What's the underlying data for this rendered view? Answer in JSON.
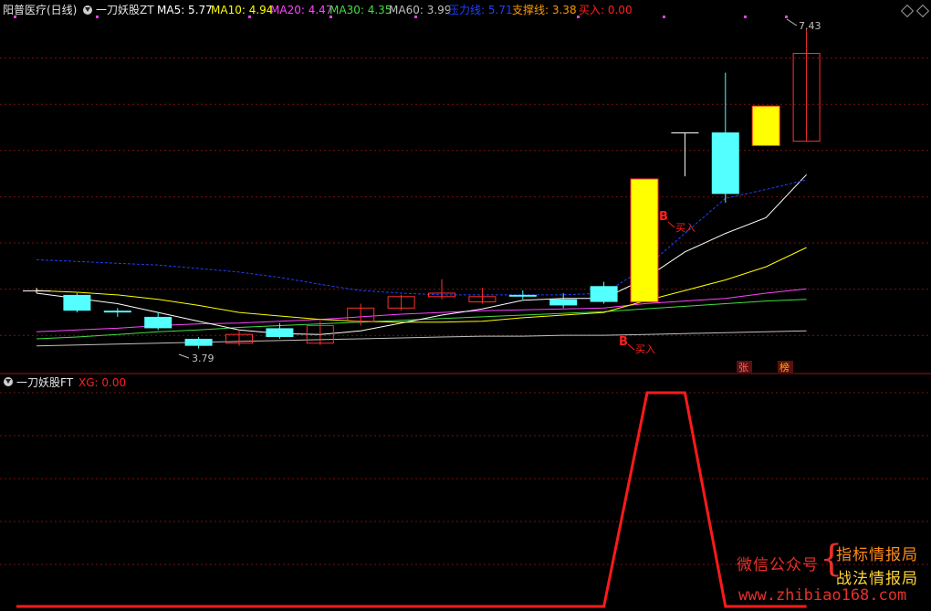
{
  "header": {
    "stock_title": "阳普医疗(日线)",
    "indicator_name": "一刀妖股ZT",
    "ma5": "MA5: 5.77",
    "ma10": "MA10: 4.94",
    "ma20": "MA20: 4.47",
    "ma30": "MA30: 4.35",
    "ma60": "MA60: 3.99",
    "pressure": "压力线: 5.71",
    "support": "支撑线: 3.38",
    "buy": "买入: 0.00"
  },
  "colors": {
    "ma5": "#ffffff",
    "ma10": "#ffff00",
    "ma20": "#ff44ff",
    "ma30": "#44dd44",
    "ma60": "#c0c0c0",
    "pressure": "#2040ff",
    "support": "#ff9900",
    "buy": "#ff2020",
    "grid": "#7a1010",
    "up": "#ff3030",
    "down": "#54ffff",
    "limit_up": "#ffff00"
  },
  "chart_labels": {
    "high_label": "7.43",
    "low_label": "3.79",
    "signal_b": "B",
    "signal_buy": "买入",
    "tag_zhang": "张",
    "tag_bang": "榜"
  },
  "subpanel": {
    "indicator_name": "一刀妖股FT",
    "xg": "XG: 0.00"
  },
  "chart_data": [
    {
      "type": "candlestick",
      "title": "阳普医疗(日线)",
      "candles": [
        {
          "o": 4.45,
          "c": 4.45,
          "h": 4.48,
          "l": 4.42
        },
        {
          "o": 4.4,
          "c": 4.22,
          "h": 4.42,
          "l": 4.2
        },
        {
          "o": 4.22,
          "c": 4.2,
          "h": 4.25,
          "l": 4.15
        },
        {
          "o": 4.15,
          "c": 4.02,
          "h": 4.2,
          "l": 4.0
        },
        {
          "o": 3.9,
          "c": 3.82,
          "h": 3.92,
          "l": 3.79
        },
        {
          "o": 3.85,
          "c": 3.95,
          "h": 4.0,
          "l": 3.82
        },
        {
          "o": 4.02,
          "c": 3.92,
          "h": 4.08,
          "l": 3.9
        },
        {
          "o": 3.85,
          "c": 4.05,
          "h": 4.1,
          "l": 3.83
        },
        {
          "o": 4.1,
          "c": 4.25,
          "h": 4.3,
          "l": 4.05
        },
        {
          "o": 4.25,
          "c": 4.38,
          "h": 4.4,
          "l": 4.22
        },
        {
          "o": 4.38,
          "c": 4.42,
          "h": 4.58,
          "l": 4.35
        },
        {
          "o": 4.32,
          "c": 4.38,
          "h": 4.48,
          "l": 4.3
        },
        {
          "o": 4.4,
          "c": 4.38,
          "h": 4.45,
          "l": 4.35
        },
        {
          "o": 4.35,
          "c": 4.28,
          "h": 4.42,
          "l": 4.25
        },
        {
          "o": 4.5,
          "c": 4.32,
          "h": 4.55,
          "l": 4.3
        },
        {
          "o": 4.32,
          "c": 5.72,
          "h": 5.72,
          "l": 4.32
        },
        {
          "o": 6.25,
          "c": 6.25,
          "h": 6.25,
          "l": 5.75
        },
        {
          "o": 6.25,
          "c": 5.55,
          "h": 6.93,
          "l": 5.45
        },
        {
          "o": 6.55,
          "c": 6.1,
          "h": 6.55,
          "l": 6.1
        },
        {
          "o": 6.15,
          "c": 7.15,
          "h": 7.43,
          "l": 6.15
        }
      ],
      "ma5": [
        4.42,
        4.36,
        4.3,
        4.2,
        4.1,
        4.0,
        3.96,
        3.95,
        3.99,
        4.08,
        4.17,
        4.24,
        4.34,
        4.36,
        4.36,
        4.58,
        4.89,
        5.1,
        5.28,
        5.77
      ],
      "ma10": [
        4.45,
        4.43,
        4.4,
        4.35,
        4.28,
        4.2,
        4.16,
        4.12,
        4.1,
        4.09,
        4.09,
        4.1,
        4.14,
        4.17,
        4.2,
        4.33,
        4.45,
        4.57,
        4.72,
        4.94
      ],
      "ma20": [
        3.98,
        4.0,
        4.02,
        4.05,
        4.07,
        4.08,
        4.1,
        4.12,
        4.15,
        4.18,
        4.2,
        4.22,
        4.23,
        4.24,
        4.25,
        4.3,
        4.33,
        4.36,
        4.42,
        4.47
      ],
      "ma30": [
        3.9,
        3.92,
        3.95,
        3.98,
        4.0,
        4.03,
        4.05,
        4.07,
        4.09,
        4.11,
        4.13,
        4.15,
        4.17,
        4.19,
        4.21,
        4.24,
        4.27,
        4.3,
        4.33,
        4.35
      ],
      "ma60": [
        3.82,
        3.83,
        3.84,
        3.85,
        3.86,
        3.87,
        3.88,
        3.89,
        3.9,
        3.91,
        3.92,
        3.93,
        3.93,
        3.94,
        3.94,
        3.95,
        3.96,
        3.97,
        3.98,
        3.99
      ],
      "pressure": [
        4.8,
        4.78,
        4.76,
        4.74,
        4.7,
        4.66,
        4.6,
        4.52,
        4.45,
        4.42,
        4.4,
        4.4,
        4.4,
        4.4,
        4.42,
        4.7,
        5.1,
        5.5,
        5.6,
        5.71
      ]
    },
    {
      "type": "line",
      "title": "一刀妖股FT",
      "series": [
        {
          "name": "XG",
          "values": [
            0,
            0,
            0,
            0,
            0,
            0,
            0,
            0,
            0,
            0,
            0,
            0,
            0,
            0,
            0,
            1,
            1,
            0,
            0,
            0
          ]
        }
      ]
    }
  ],
  "watermark": {
    "line1": "微信公众号",
    "line2": "指标情报局",
    "line3": "战法情报局",
    "line4": "www.zhibiao168.com"
  }
}
